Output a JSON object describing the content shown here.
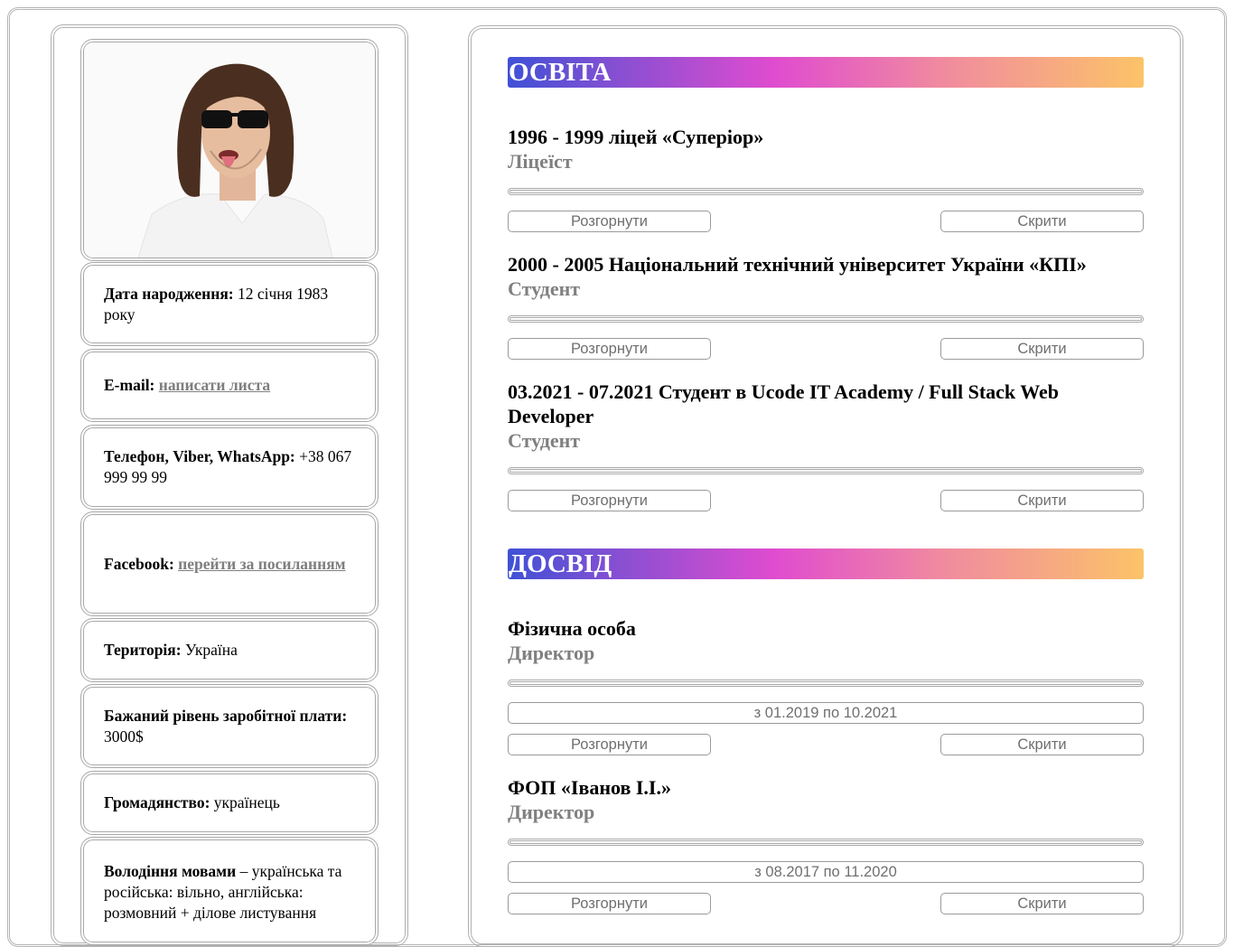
{
  "sidebar": {
    "photo_alt": "",
    "birth": {
      "label": "Дата народження:",
      "value": " 12 січня 1983 року"
    },
    "email": {
      "label": "E-mail:",
      "link": "написати листа"
    },
    "phone": {
      "label": "Телефон, Viber, WhatsApp:",
      "value": " +38 067 999 99 99"
    },
    "facebook": {
      "label": "Facebook:",
      "link": "перейти за посиланням"
    },
    "territory": {
      "label": "Територія:",
      "value": " Україна"
    },
    "salary": {
      "label": "Бажаний рівень заробітної плати:",
      "value": " 3000$"
    },
    "citizenship": {
      "label": "Громадянство:",
      "value": " українець"
    },
    "languages": {
      "label": "Володіння мовами",
      "value": " – українська та російська: вільно, англійська: розмовний + ділове листування"
    }
  },
  "education": {
    "title": "ОСВІТА",
    "entries": [
      {
        "title": "1996 - 1999 ліцей «Суперіор»",
        "role": "Ліцеїст"
      },
      {
        "title": "2000 - 2005 Національний технічний університет України «КПІ»",
        "role": "Студент"
      },
      {
        "title": "03.2021 - 07.2021 Студент в Ucode IT Academy / Full Stack Web Developer",
        "role": "Студент"
      }
    ]
  },
  "experience": {
    "title": "ДОСВІД",
    "entries": [
      {
        "title": "Фізична особа",
        "role": "Директор",
        "period": "з 01.2019 по 10.2021"
      },
      {
        "title": "ФОП «Іванов І.І.»",
        "role": "Директор",
        "period": "з 08.2017 по 11.2020"
      }
    ]
  },
  "buttons": {
    "expand": "Розгорнути",
    "hide": "Скрити"
  }
}
